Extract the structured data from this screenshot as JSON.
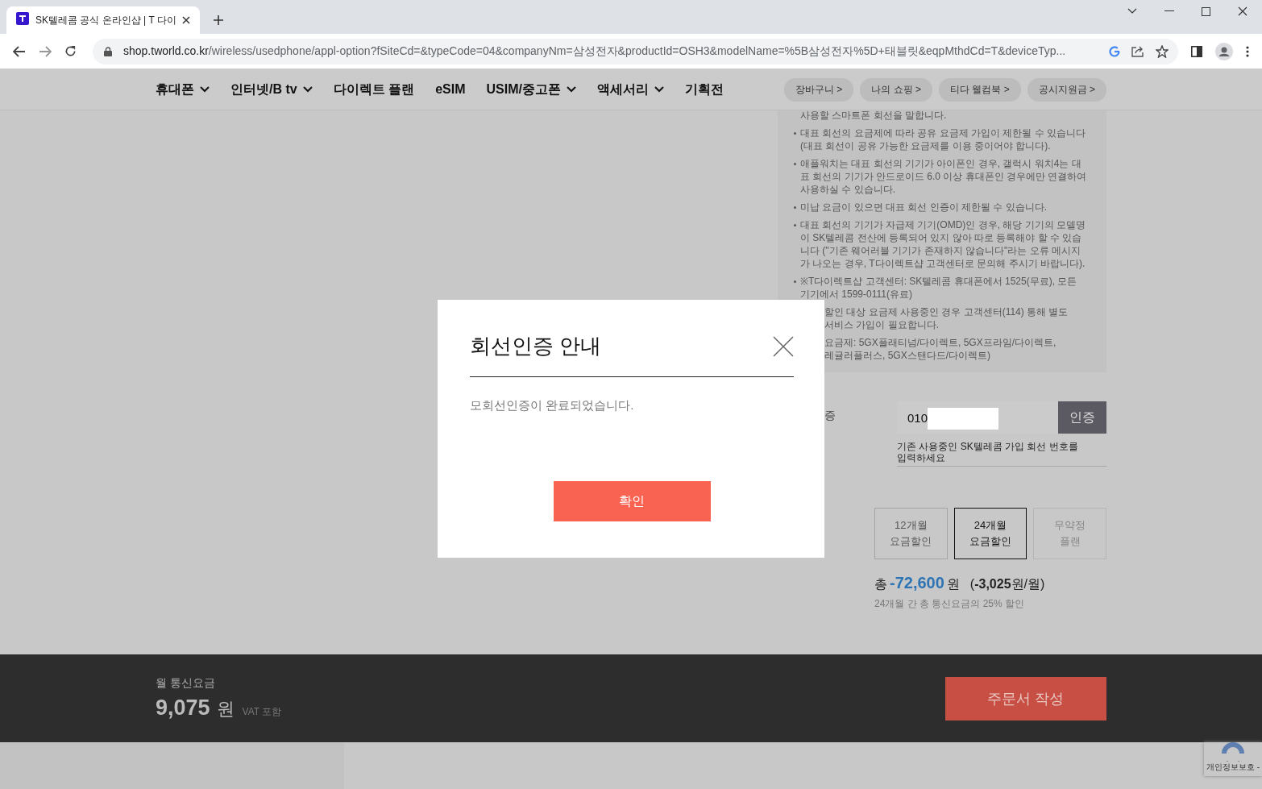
{
  "browser": {
    "tab": {
      "title": "SK텔레콤 공식 온라인샵 | T 다이"
    },
    "url": {
      "host": "shop.tworld.co.kr",
      "path": "/wireless/usedphone/appl-option?fSiteCd=&typeCode=04&companyNm=삼성전자&productId=OSH3&modelName=%5B삼성전자%5D+태블릿&eqpMthdCd=T&deviceTyp..."
    }
  },
  "nav": {
    "items": [
      {
        "label": "휴대폰",
        "dropdown": true
      },
      {
        "label": "인터넷/B tv",
        "dropdown": true
      },
      {
        "label": "다이렉트 플랜",
        "dropdown": false
      },
      {
        "label": "eSIM",
        "dropdown": false
      },
      {
        "label": "USIM/중고폰",
        "dropdown": true
      },
      {
        "label": "액세서리",
        "dropdown": true
      },
      {
        "label": "기획전",
        "dropdown": false
      }
    ],
    "quick_links": [
      "장바구니 >",
      "나의 쇼핑 >",
      "티다 웰컴북 >",
      "공시지원금 >"
    ]
  },
  "notice": [
    {
      "kind": "continuation",
      "text": "사용할 스마트폰 회선을 말합니다."
    },
    {
      "kind": "bullet",
      "text": "대표 회선의 요금제에 따라 공유 요금제 가입이 제한될 수 있습니다 (대표 회선이 공유 가능한 요금제를 이용 중이어야 합니다)."
    },
    {
      "kind": "bullet",
      "text": "애플워치는 대표 회선의 기기가 아이폰인 경우, 갤럭시 워치4는 대표 회선의 기기가 안드로이드 6.0 이상 휴대폰인 경우에만 연결하여 사용하실 수 있습니다."
    },
    {
      "kind": "bullet",
      "text": "미납 요금이 있으면 대표 회선 인증이 제한될 수 있습니다."
    },
    {
      "kind": "bullet",
      "text": "대표 회선의 기기가 자급제 기기(OMD)인 경우, 해당 기기의 모델명이 SK텔레콤 전산에 등록되어 있지 않아 따로 등록해야 할 수 있습니다 (\"기존 웨어러블 기기가 존재하지 않습니다\"라는 오류 메시지가 나오는 경우, T다이렉트샵 고객센터로 문의해 주시기 바랍니다)."
    },
    {
      "kind": "bullet",
      "text": "※T다이렉트샵 고객센터: SK텔레콤 휴대폰에서 1525(무료), 모든 기기에서 1599-0111(유료)"
    },
    {
      "kind": "covered",
      "lines": [
        "할인 대상 요금제 사용중인 경우 고객센터(114) 통해 별도",
        "서비스 가입이 필요합니다."
      ]
    },
    {
      "kind": "covered",
      "lines": [
        "요금제: 5GX플래티넘/다이렉트, 5GX프라임/다이렉트,",
        "레귤러플러스, 5GX스탠다드/다이렉트)"
      ]
    }
  ],
  "verification": {
    "label": "증",
    "value": "010",
    "button": "인증",
    "hint": "기존 사용중인 SK텔레콤 가입 회선 번호를 입력하세요"
  },
  "plans": [
    {
      "lines": [
        "12개월",
        "요금할인"
      ],
      "selected": false,
      "disabled": false
    },
    {
      "lines": [
        "24개월",
        "요금할인"
      ],
      "selected": true,
      "disabled": false
    },
    {
      "lines": [
        "무약정",
        "플랜"
      ],
      "selected": false,
      "disabled": true
    }
  ],
  "total": {
    "prefix": "총",
    "amount": "-72,600",
    "unit": "원",
    "monthly": "(**-3,025**원/월)",
    "note": "24개월 간 총 통신요금의 25% 할인"
  },
  "footer": {
    "label": "월 통신요금",
    "price": "9,075",
    "unit": "원",
    "vat": "VAT 포함",
    "order_button": "주문서 작성"
  },
  "recaptcha": {
    "text": "개인정보보호 -"
  },
  "modal": {
    "title": "회선인증 안내",
    "message": "모회선인증이 완료되었습니다.",
    "confirm": "확인"
  }
}
